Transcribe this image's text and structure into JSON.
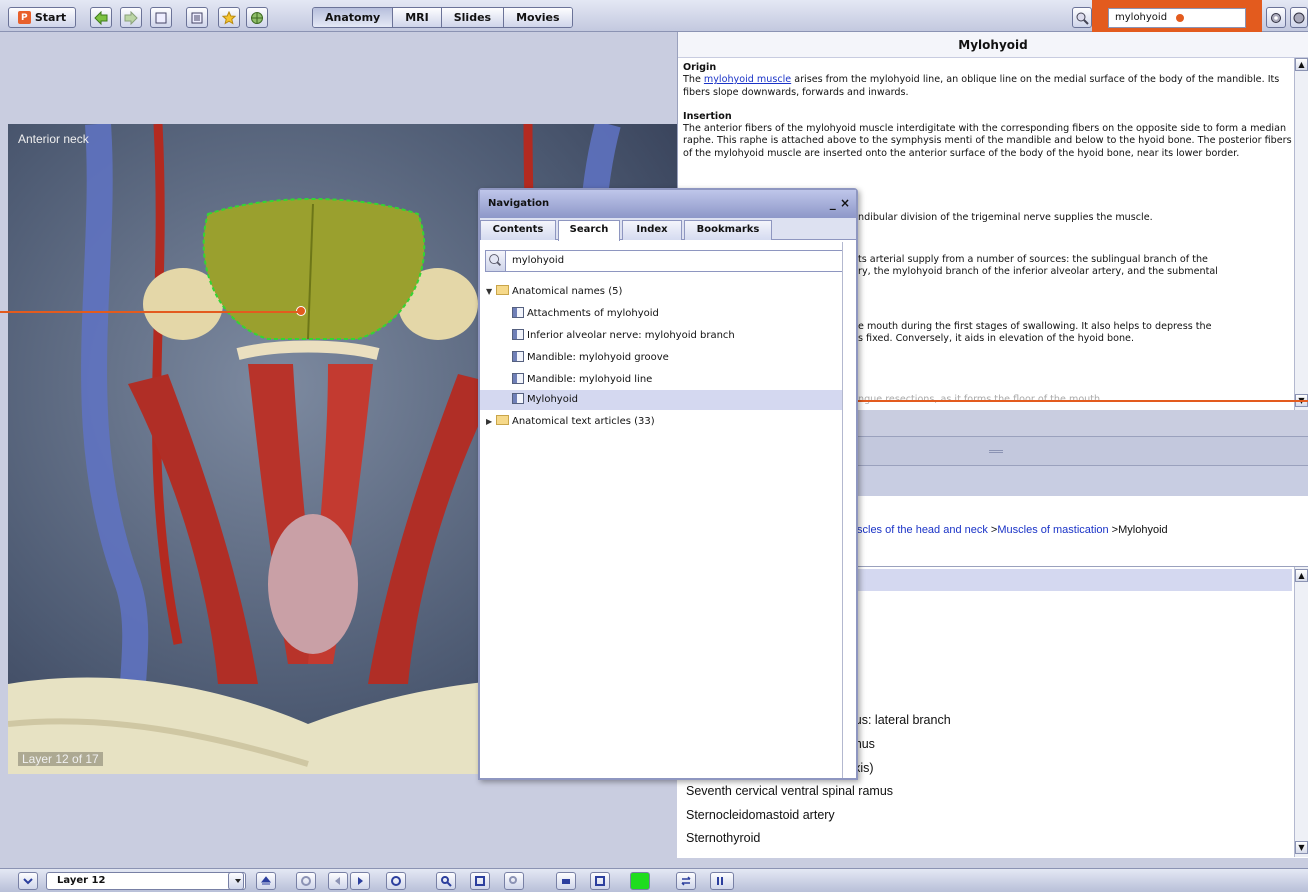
{
  "toolbar": {
    "start_label": "Start",
    "start_logo": "P",
    "tabs": [
      "Anatomy",
      "MRI",
      "Slides",
      "Movies"
    ],
    "active_tab": "Anatomy",
    "search_value": "mylohyoid",
    "icons": [
      "back-arrow-icon",
      "forward-arrow-icon",
      "page-icon",
      "list-icon",
      "star-icon",
      "globe-icon",
      "search-icon",
      "settings-icon",
      "help-icon"
    ]
  },
  "viewer": {
    "view_label": "Anterior neck",
    "layer_label": "Layer 12 of 17"
  },
  "article": {
    "title": "Mylohyoid",
    "origin_heading": "Origin",
    "origin_pre": "The ",
    "origin_link": "mylohyoid muscle",
    "origin_post": " arises from the mylohyoid line, an oblique line on the medial surface of the body of the mandible. Its fibers slope downwards, forwards and inwards.",
    "insertion_heading": "Insertion",
    "insertion_text": "The anterior fibers of the mylohyoid muscle interdigitate with the corresponding fibers on the opposite side to form a median raphe. This raphe is attached above to the symphysis menti of the mandible and below to the hyoid bone. The posterior fibers of the mylohyoid muscle are inserted onto the anterior surface of the body of the hyoid bone, near its lower border.",
    "nerve_fragment": "ndibular division of the trigeminal nerve supplies the muscle.",
    "blood_fragment_1": "ts arterial supply from a number of sources: the sublingual branch of the",
    "blood_fragment_2": "ry, the mylohyoid branch of the inferior alveolar artery, and the submental",
    "action_fragment_1": "e mouth during the first stages of swallowing. It also helps to depress the",
    "action_fragment_2": "s fixed. Conversely, it aids in elevation of the hyoid bone.",
    "clinical_fragment": "ngue resections, as it forms the floor of the mouth."
  },
  "breadcrumb": {
    "part1": "scles of the head and neck",
    "sep1": " >",
    "part2": "Muscles of mastication",
    "sep2": " >",
    "part3": "Mylohyoid"
  },
  "structure_list": [
    "l ramus: lateral branch",
    "al ramus",
    "yn. axis)",
    "Seventh cervical ventral spinal ramus",
    "Sternocleidomastoid artery",
    "Sternothyroid"
  ],
  "navigation": {
    "title": "Navigation",
    "minimize": "_",
    "close": "×",
    "tabs": [
      "Contents",
      "Search",
      "Index",
      "Bookmarks"
    ],
    "active_tab": "Search",
    "search_value": "mylohyoid",
    "group1": "Anatomical names (5)",
    "results": [
      "Attachments of mylohyoid",
      "Inferior alveolar nerve: mylohyoid branch",
      "Mandible: mylohyoid groove",
      "Mandible: mylohyoid line",
      "Mylohyoid"
    ],
    "selected_result": "Mylohyoid",
    "group2": "Anatomical text articles (33)"
  },
  "bottombar": {
    "layer_select": "Layer 12"
  },
  "colors": {
    "accent_orange": "#e35b1e",
    "link_blue": "#1a33c7",
    "highlight_green": "#1fdc1f"
  }
}
